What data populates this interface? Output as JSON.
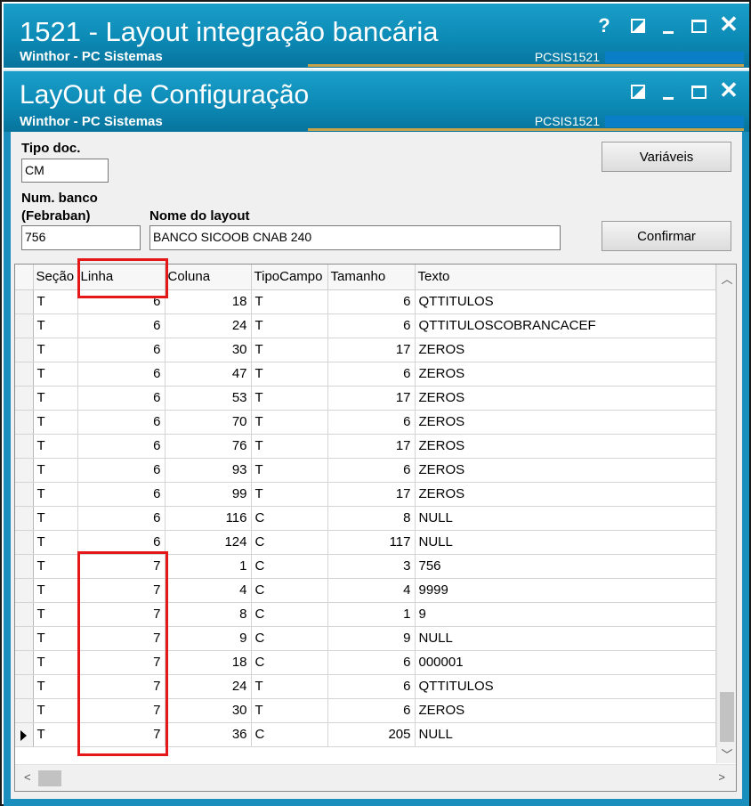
{
  "outer_window": {
    "title": "1521 - Layout integração bancária",
    "subtitle": "Winthor - PC Sistemas",
    "code": "PCSIS1521",
    "help_label": "?"
  },
  "inner_window": {
    "title": "LayOut de Configuração",
    "subtitle": "Winthor - PC Sistemas",
    "code": "PCSIS1521"
  },
  "form": {
    "tipo_doc_label": "Tipo doc.",
    "tipo_doc_value": "CM",
    "num_banco_label_1": "Num. banco",
    "num_banco_label_2": "(Febraban)",
    "num_banco_value": "756",
    "nome_layout_label": "Nome do layout",
    "nome_layout_value": "BANCO SICOOB CNAB 240",
    "variaveis_button": "Variáveis",
    "confirmar_button": "Confirmar"
  },
  "grid": {
    "columns": [
      "Seção",
      "Linha",
      "Coluna",
      "TipoCampo",
      "Tamanho",
      "Texto"
    ],
    "rows": [
      [
        "T",
        "6",
        "18",
        "T",
        "6",
        "QTTITULOS"
      ],
      [
        "T",
        "6",
        "24",
        "T",
        "6",
        "QTTITULOSCOBRANCACEF"
      ],
      [
        "T",
        "6",
        "30",
        "T",
        "17",
        "ZEROS"
      ],
      [
        "T",
        "6",
        "47",
        "T",
        "6",
        "ZEROS"
      ],
      [
        "T",
        "6",
        "53",
        "T",
        "17",
        "ZEROS"
      ],
      [
        "T",
        "6",
        "70",
        "T",
        "6",
        "ZEROS"
      ],
      [
        "T",
        "6",
        "76",
        "T",
        "17",
        "ZEROS"
      ],
      [
        "T",
        "6",
        "93",
        "T",
        "6",
        "ZEROS"
      ],
      [
        "T",
        "6",
        "99",
        "T",
        "17",
        "ZEROS"
      ],
      [
        "T",
        "6",
        "116",
        "C",
        "8",
        "NULL"
      ],
      [
        "T",
        "6",
        "124",
        "C",
        "117",
        "NULL"
      ],
      [
        "T",
        "7",
        "1",
        "C",
        "3",
        "756"
      ],
      [
        "T",
        "7",
        "4",
        "C",
        "4",
        "9999"
      ],
      [
        "T",
        "7",
        "8",
        "C",
        "1",
        "9"
      ],
      [
        "T",
        "7",
        "9",
        "C",
        "9",
        "NULL"
      ],
      [
        "T",
        "7",
        "18",
        "C",
        "6",
        "000001"
      ],
      [
        "T",
        "7",
        "24",
        "T",
        "6",
        "QTTITULOS"
      ],
      [
        "T",
        "7",
        "30",
        "T",
        "6",
        "ZEROS"
      ],
      [
        "T",
        "7",
        "36",
        "C",
        "205",
        "NULL"
      ]
    ],
    "current_row_index": 18
  },
  "colors": {
    "titlebar": "#0c8ab6",
    "highlight": "#e41818"
  }
}
